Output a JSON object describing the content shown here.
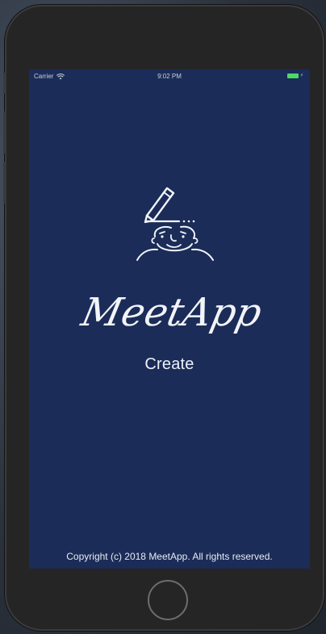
{
  "status_bar": {
    "carrier": "Carrier",
    "time": "9:02 PM",
    "battery_color": "#4cd964"
  },
  "brand": {
    "name": "MeetApp",
    "logo_icon": "face-with-pencil-icon"
  },
  "actions": {
    "create_label": "Create"
  },
  "footer": {
    "copyright": "Copyright (c) 2018 MeetApp. All rights reserved."
  },
  "device": {
    "home_button_icon": "home-button-circle"
  },
  "colors": {
    "screen_background": "#1b2c58",
    "text": "#eef1f7",
    "device_frame": "#252526"
  }
}
